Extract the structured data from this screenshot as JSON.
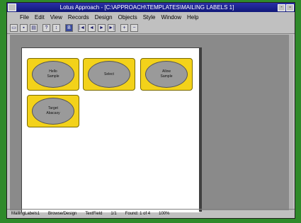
{
  "window": {
    "title": "Lotus Approach - [C:\\APPROACH\\TEMPLATES\\MAILING LABELS 1]",
    "controls": {
      "minimize": "-",
      "restore": "▫"
    }
  },
  "menu": [
    "File",
    "Edit",
    "View",
    "Records",
    "Design",
    "Objects",
    "Style",
    "Window",
    "Help"
  ],
  "toolbar": {
    "buttons": [
      {
        "icon": "open-icon",
        "glyph": "▭"
      },
      {
        "icon": "save-icon",
        "glyph": "▪"
      },
      {
        "icon": "print-icon",
        "glyph": "▤"
      },
      {
        "icon": "find-icon",
        "glyph": "?"
      },
      {
        "icon": "sort-icon",
        "glyph": "↕"
      },
      {
        "icon": "browse-icon",
        "glyph": "B"
      },
      {
        "icon": "first-record-icon",
        "glyph": "|◄"
      },
      {
        "icon": "prev-record-icon",
        "glyph": "◄"
      },
      {
        "icon": "next-record-icon",
        "glyph": "►"
      },
      {
        "icon": "last-record-icon",
        "glyph": "►|"
      },
      {
        "icon": "zoom-in-icon",
        "glyph": "+"
      },
      {
        "icon": "zoom-out-icon",
        "glyph": "−"
      }
    ]
  },
  "labels": [
    {
      "line1": "Hello",
      "line2": "Sample"
    },
    {
      "line1": "Select",
      "line2": ""
    },
    {
      "line1": "Allow",
      "line2": "Sample"
    },
    {
      "line1": "Target",
      "line2": "Abacaxy"
    }
  ],
  "status": {
    "view": "MailingLabels1",
    "browse": "Browse/Design",
    "field": "TextField",
    "records": "1/1",
    "found": "Found: 1 of 4",
    "zoom": "100%"
  },
  "colors": {
    "label_fill": "#f3d21a",
    "ellipse_fill": "#9a9a9a",
    "title_bar": "#1a2290"
  }
}
